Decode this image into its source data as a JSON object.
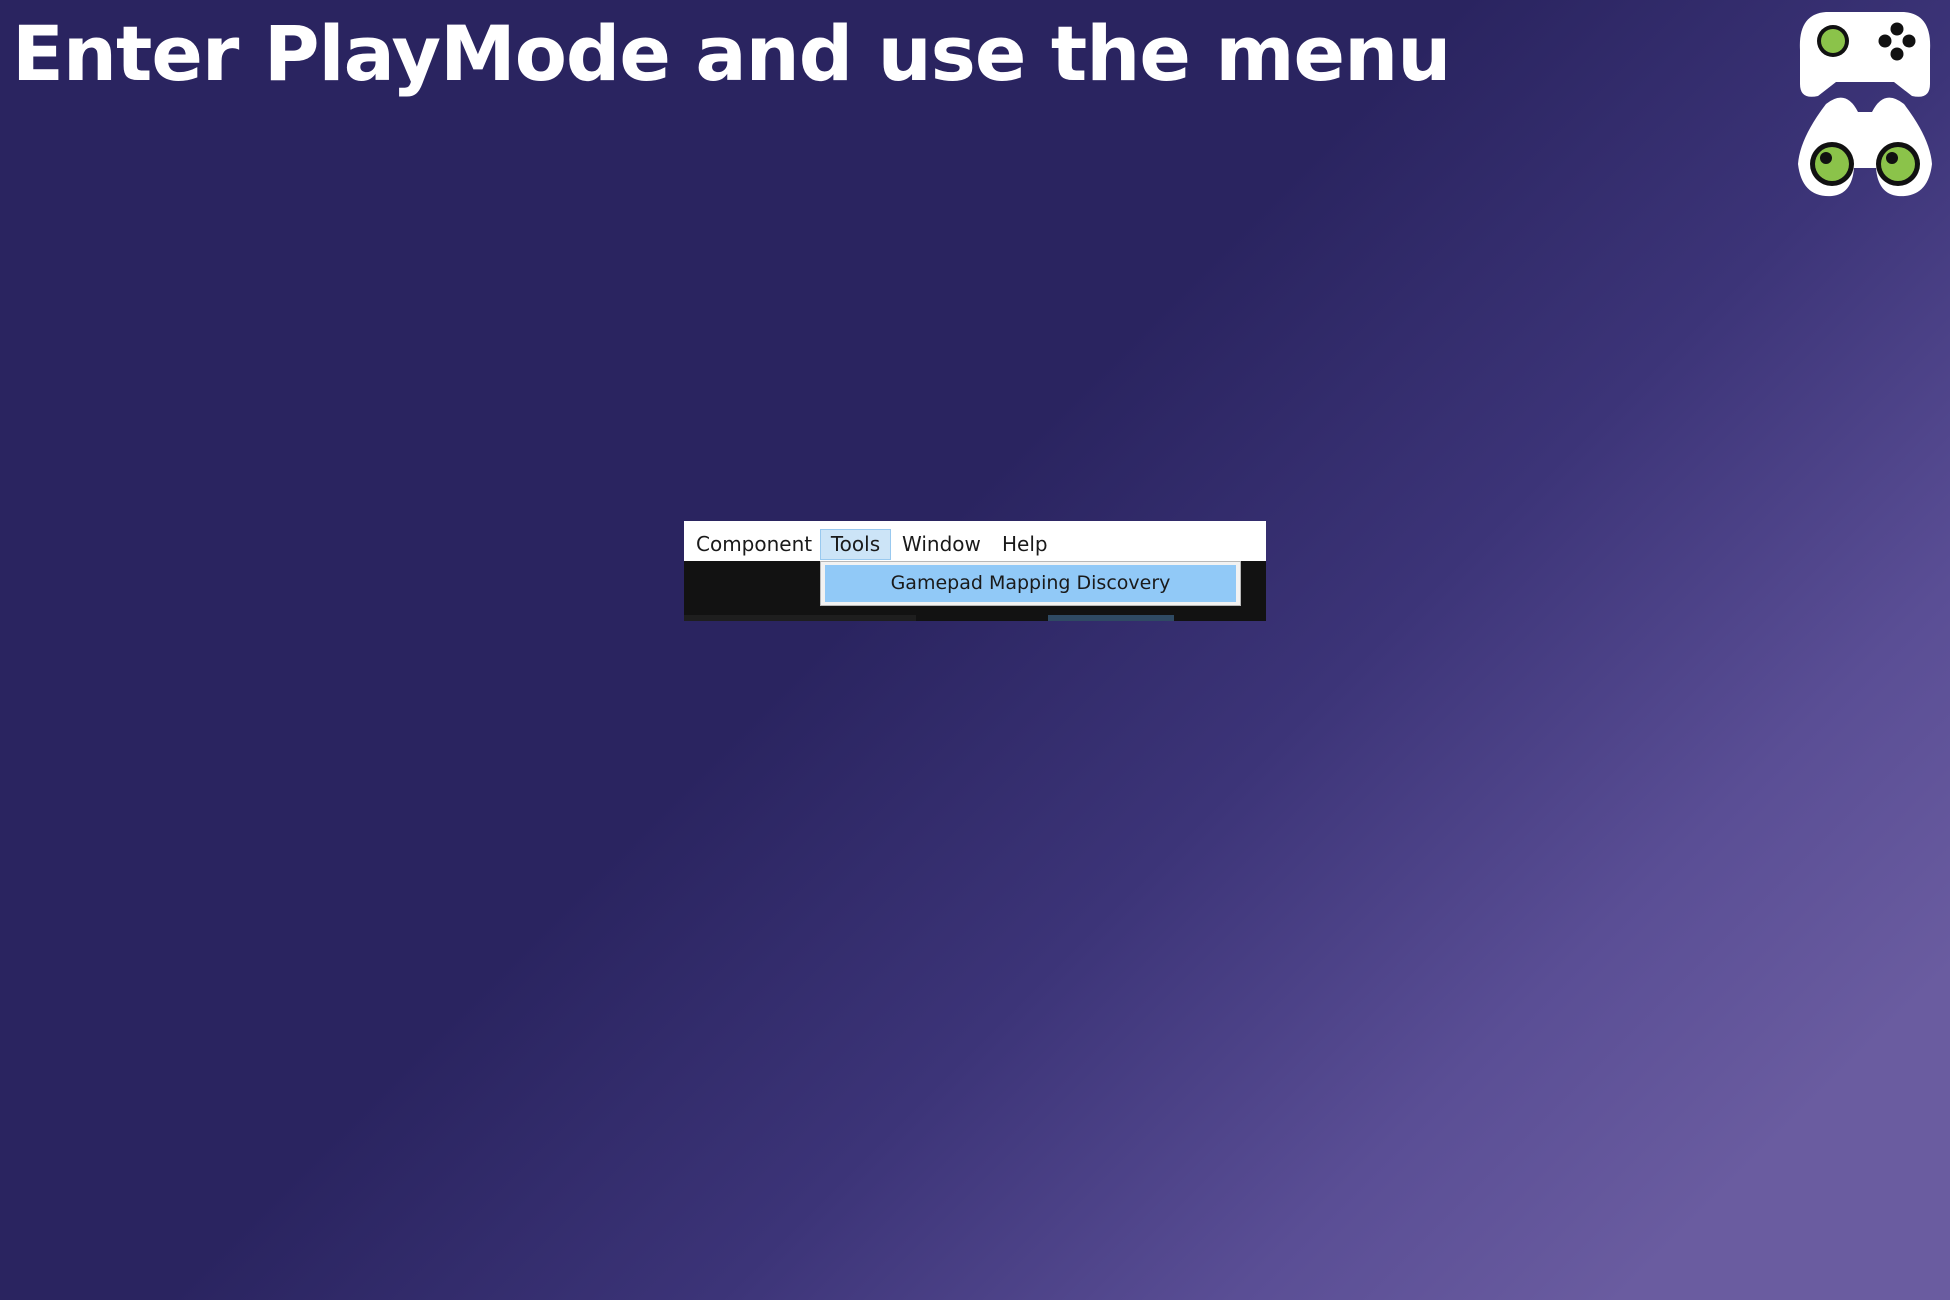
{
  "heading": {
    "text": "Enter PlayMode and use the menu"
  },
  "logo": {
    "icons": [
      "gamepad-icon",
      "binoculars-icon"
    ],
    "accent": "#8bc34a"
  },
  "menubar": {
    "items": [
      {
        "label": "Component",
        "active": false
      },
      {
        "label": "Tools",
        "active": true
      },
      {
        "label": "Window",
        "active": false
      },
      {
        "label": "Help",
        "active": false
      }
    ]
  },
  "tools_menu": {
    "items": [
      {
        "label": "Gamepad Mapping Discovery",
        "highlighted": true
      }
    ]
  },
  "colors": {
    "background_dark": "#2a2460",
    "background_light": "#6a5ca0",
    "menu_hover": "#cce4f7",
    "menu_highlight": "#91c9f7"
  }
}
